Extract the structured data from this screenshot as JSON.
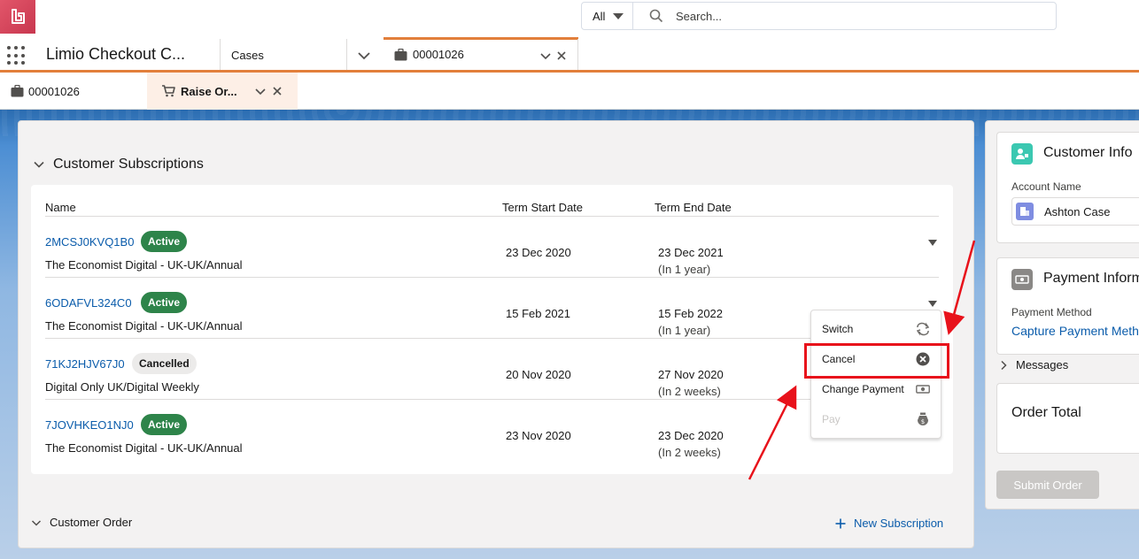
{
  "header": {
    "search_scope": "All",
    "search_placeholder": "Search..."
  },
  "nav": {
    "app_name": "Limio Checkout C...",
    "cases_label": "Cases",
    "active_tab_label": "00001026"
  },
  "subtabs": [
    {
      "label": "00001026"
    },
    {
      "label": "Raise Or..."
    }
  ],
  "subscriptions": {
    "section_title": "Customer Subscriptions",
    "columns": {
      "name": "Name",
      "start": "Term Start Date",
      "end": "Term End Date"
    },
    "rows": [
      {
        "id": "2MCSJ0KVQ1B0",
        "status": "Active",
        "product": "The Economist Digital - UK-UK/Annual",
        "start": "23 Dec 2020",
        "end": "23 Dec 2021",
        "end_relative": "(In 1 year)"
      },
      {
        "id": "6ODAFVL324C0",
        "status": "Active",
        "product": "The Economist Digital - UK-UK/Annual",
        "start": "15 Feb 2021",
        "end": "15 Feb 2022",
        "end_relative": "(In 1 year)"
      },
      {
        "id": "71KJ2HJV67J0",
        "status": "Cancelled",
        "product": "Digital Only UK/Digital Weekly",
        "start": "20 Nov 2020",
        "end": "27 Nov 2020",
        "end_relative": "(In 2 weeks)"
      },
      {
        "id": "7JOVHKEO1NJ0",
        "status": "Active",
        "product": "The Economist Digital - UK-UK/Annual",
        "start": "23 Nov 2020",
        "end": "23 Dec 2020",
        "end_relative": "(In 2 weeks)"
      }
    ]
  },
  "row_menu": {
    "items": [
      {
        "label": "Switch",
        "icon": "switch-icon",
        "disabled": false
      },
      {
        "label": "Cancel",
        "icon": "cancel-circle-icon",
        "disabled": false
      },
      {
        "label": "Change Payment",
        "icon": "money-icon",
        "disabled": false
      },
      {
        "label": "Pay",
        "icon": "money-bag-icon",
        "disabled": true
      }
    ]
  },
  "order": {
    "section_title": "Customer Order",
    "new_subscription_label": "New Subscription"
  },
  "sidebar": {
    "customer_info_title": "Customer Info",
    "account_name_label": "Account Name",
    "account_name_value": "Ashton Case",
    "payment_info_title": "Payment Inform",
    "payment_method_label": "Payment Method",
    "payment_method_link": "Capture Payment Meth",
    "messages_label": "Messages",
    "order_total_title": "Order Total",
    "submit_label": "Submit Order"
  },
  "colors": {
    "accent_orange": "#e27f3b",
    "active_badge": "#2e844a",
    "link_blue": "#0b5cab",
    "annotation_red": "#e8121b"
  }
}
